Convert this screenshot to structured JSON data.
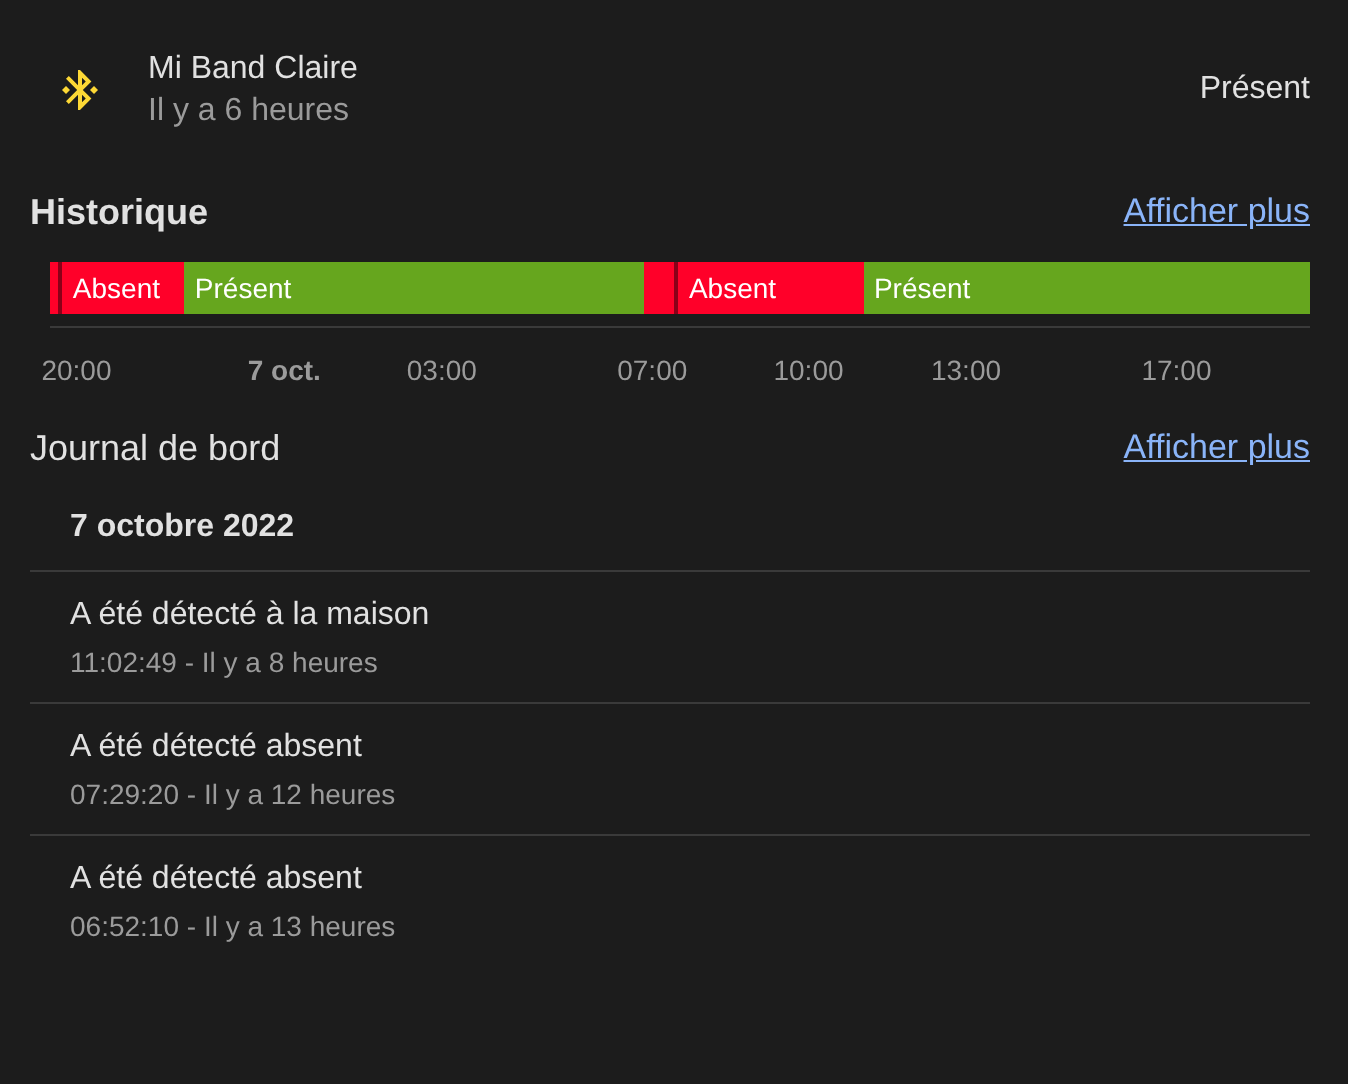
{
  "entity": {
    "name": "Mi Band Claire",
    "last_changed": "Il y a 6 heures",
    "state": "Présent"
  },
  "history": {
    "title": "Historique",
    "more_link": "Afficher plus",
    "segments": [
      {
        "kind": "absent"
      },
      {
        "kind": "absent",
        "label": "Absent"
      },
      {
        "kind": "present",
        "label": "Présent"
      },
      {
        "kind": "absent"
      },
      {
        "kind": "absent",
        "label": "Absent"
      },
      {
        "kind": "present",
        "label": "Présent"
      }
    ],
    "ticks": [
      {
        "label": "20:00",
        "bold": false
      },
      {
        "label": "7 oct.",
        "bold": true
      },
      {
        "label": "03:00",
        "bold": false
      },
      {
        "label": "07:00",
        "bold": false
      },
      {
        "label": "10:00",
        "bold": false
      },
      {
        "label": "13:00",
        "bold": false
      },
      {
        "label": "17:00",
        "bold": false
      }
    ]
  },
  "logbook": {
    "title": "Journal de bord",
    "more_link": "Afficher plus",
    "date": "7 octobre 2022",
    "entries": [
      {
        "message": "A été détecté à la maison",
        "time": "11:02:49 - Il y a 8 heures"
      },
      {
        "message": "A été détecté absent",
        "time": "07:29:20 - Il y a 12 heures"
      },
      {
        "message": "A été détecté absent",
        "time": "06:52:10 - Il y a 13 heures"
      }
    ]
  }
}
